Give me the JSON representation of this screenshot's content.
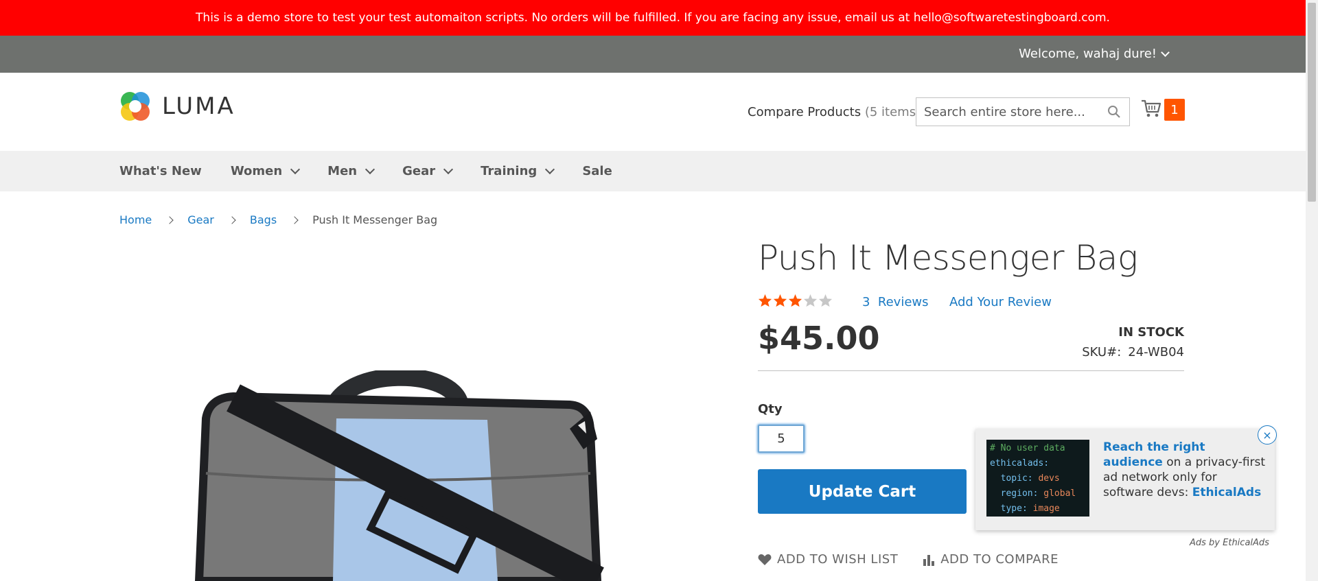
{
  "banner": {
    "text": "This is a demo store to test your test automaiton scripts. No orders will be fulfilled. If you are facing any issue, email us at hello@softwaretestingboard.com."
  },
  "header": {
    "welcome": "Welcome, wahaj dure!",
    "logo_text": "LUMA",
    "compare_label": "Compare Products",
    "compare_count": "(5 items)",
    "search_placeholder": "Search entire store here...",
    "cart_count": "1"
  },
  "nav": {
    "items": [
      {
        "label": "What's New",
        "dropdown": false
      },
      {
        "label": "Women",
        "dropdown": true
      },
      {
        "label": "Men",
        "dropdown": true
      },
      {
        "label": "Gear",
        "dropdown": true
      },
      {
        "label": "Training",
        "dropdown": true
      },
      {
        "label": "Sale",
        "dropdown": false
      }
    ]
  },
  "breadcrumbs": {
    "items": [
      "Home",
      "Gear",
      "Bags"
    ],
    "current": "Push It Messenger Bag"
  },
  "product": {
    "title": "Push It Messenger Bag",
    "rating": 0.6,
    "reviews_count": "3",
    "reviews_label": "Reviews",
    "add_review": "Add Your Review",
    "price": "$45.00",
    "stock": "In stock",
    "sku_label": "SKU#:",
    "sku": "24-WB04",
    "qty_label": "Qty",
    "qty_value": "5",
    "update_button": "Update Cart",
    "wishlist": "Add to Wish List",
    "compare": "Add to Compare"
  },
  "ad": {
    "code": {
      "comment": "# No user data",
      "key": "ethicalads:",
      "lines": [
        {
          "k": "topic:",
          "v": "devs"
        },
        {
          "k": "region:",
          "v": "global"
        },
        {
          "k": "type:",
          "v": "image"
        }
      ]
    },
    "headline": "Reach the right audience",
    "body": "on a privacy-first ad network only for software devs:",
    "brand": "EthicalAds",
    "close": "×",
    "attribution": "Ads by EthicalAds"
  },
  "colors": {
    "banner": "#ff0000",
    "accent": "#1979c3",
    "cart_badge": "#ff5501",
    "star": "#ff5501"
  }
}
